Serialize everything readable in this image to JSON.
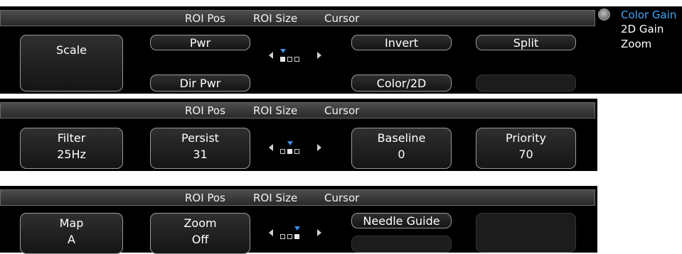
{
  "tabs": [
    "ROI Pos",
    "ROI Size",
    "Cursor"
  ],
  "panel1": {
    "scale_label": "Scale",
    "pwr_label": "Pwr",
    "dir_pwr_label": "Dir Pwr",
    "invert_label": "Invert",
    "color2d_label": "Color/2D",
    "split_label": "Split",
    "page_indicator": {
      "current_page": 1,
      "total_pages": 3
    }
  },
  "panel2": {
    "filter": {
      "label": "Filter",
      "value": "25Hz"
    },
    "persist": {
      "label": "Persist",
      "value": "31"
    },
    "baseline": {
      "label": "Baseline",
      "value": "0"
    },
    "priority": {
      "label": "Priority",
      "value": "70"
    },
    "page_indicator": {
      "current_page": 2,
      "total_pages": 3
    }
  },
  "panel3": {
    "map": {
      "label": "Map",
      "value": "A"
    },
    "zoom": {
      "label": "Zoom",
      "value": "Off"
    },
    "needle_guide_label": "Needle Guide",
    "page_indicator": {
      "current_page": 3,
      "total_pages": 3
    }
  },
  "side_menu": {
    "items": [
      "Color Gain",
      "2D Gain",
      "Zoom"
    ],
    "active_item": "Color Gain",
    "active_color": "#3fa7ff",
    "knob_icon": "rotary-knob-icon"
  }
}
